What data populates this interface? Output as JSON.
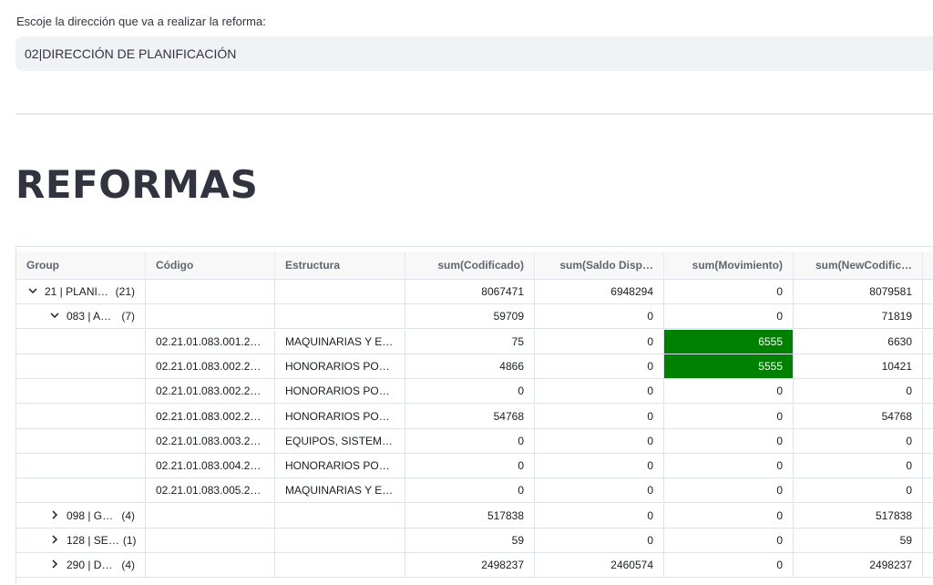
{
  "select": {
    "label": "Escoje la dirección que va a realizar la reforma:",
    "value": "02|DIRECCIÓN DE PLANIFICACIÓN"
  },
  "title": "REFORMAS",
  "grid": {
    "headers": [
      "Group",
      "Código",
      "Estructura",
      "sum(Codificado)",
      "sum(Saldo Disp…",
      "sum(Movimiento)",
      "sum(NewCodific…"
    ],
    "rows": [
      {
        "level": 0,
        "chevron": "down",
        "group": "21 | PLANI…",
        "count": "(21)",
        "codigo": "",
        "estructura": "",
        "codificado": "8067471",
        "saldo": "6948294",
        "movimiento": "0",
        "newcodificado": "8079581",
        "highlight": false
      },
      {
        "level": 1,
        "chevron": "down",
        "group": "083 | A…",
        "count": "(7)",
        "codigo": "",
        "estructura": "",
        "codificado": "59709",
        "saldo": "0",
        "movimiento": "0",
        "newcodificado": "71819",
        "highlight": false
      },
      {
        "level": 2,
        "chevron": "",
        "group": "",
        "count": "",
        "codigo": "02.21.01.083.001.2…",
        "estructura": "MAQUINARIAS Y EQ…",
        "codificado": "75",
        "saldo": "0",
        "movimiento": "6555",
        "newcodificado": "6630",
        "highlight": true
      },
      {
        "level": 2,
        "chevron": "",
        "group": "",
        "count": "",
        "codigo": "02.21.01.083.002.2…",
        "estructura": "HONORARIOS POR …",
        "codificado": "4866",
        "saldo": "0",
        "movimiento": "5555",
        "newcodificado": "10421",
        "highlight": true
      },
      {
        "level": 2,
        "chevron": "",
        "group": "",
        "count": "",
        "codigo": "02.21.01.083.002.2…",
        "estructura": "HONORARIOS POR …",
        "codificado": "0",
        "saldo": "0",
        "movimiento": "0",
        "newcodificado": "0",
        "highlight": false
      },
      {
        "level": 2,
        "chevron": "",
        "group": "",
        "count": "",
        "codigo": "02.21.01.083.002.2…",
        "estructura": "HONORARIOS POR …",
        "codificado": "54768",
        "saldo": "0",
        "movimiento": "0",
        "newcodificado": "54768",
        "highlight": false
      },
      {
        "level": 2,
        "chevron": "",
        "group": "",
        "count": "",
        "codigo": "02.21.01.083.003.2…",
        "estructura": "EQUIPOS, SISTEMA…",
        "codificado": "0",
        "saldo": "0",
        "movimiento": "0",
        "newcodificado": "0",
        "highlight": false
      },
      {
        "level": 2,
        "chevron": "",
        "group": "",
        "count": "",
        "codigo": "02.21.01.083.004.2…",
        "estructura": "HONORARIOS POR …",
        "codificado": "0",
        "saldo": "0",
        "movimiento": "0",
        "newcodificado": "0",
        "highlight": false
      },
      {
        "level": 2,
        "chevron": "",
        "group": "",
        "count": "",
        "codigo": "02.21.01.083.005.2…",
        "estructura": "MAQUINARIAS Y EQ…",
        "codificado": "0",
        "saldo": "0",
        "movimiento": "0",
        "newcodificado": "0",
        "highlight": false
      },
      {
        "level": 1,
        "chevron": "right",
        "group": "098 | G…",
        "count": "(4)",
        "codigo": "",
        "estructura": "",
        "codificado": "517838",
        "saldo": "0",
        "movimiento": "0",
        "newcodificado": "517838",
        "highlight": false
      },
      {
        "level": 1,
        "chevron": "right",
        "group": "128 | SE…",
        "count": "(1)",
        "codigo": "",
        "estructura": "",
        "codificado": "59",
        "saldo": "0",
        "movimiento": "0",
        "newcodificado": "59",
        "highlight": false
      },
      {
        "level": 1,
        "chevron": "right",
        "group": "290 | D…",
        "count": "(4)",
        "codigo": "",
        "estructura": "",
        "codificado": "2498237",
        "saldo": "2460574",
        "movimiento": "0",
        "newcodificado": "2498237",
        "highlight": false
      }
    ]
  },
  "colors": {
    "highlight": "#008000",
    "header_bg": "#f8f8f8",
    "select_bg": "#f0f2f6"
  },
  "icons": {
    "expanded": "chevron-down-icon",
    "collapsed": "chevron-right-icon"
  }
}
